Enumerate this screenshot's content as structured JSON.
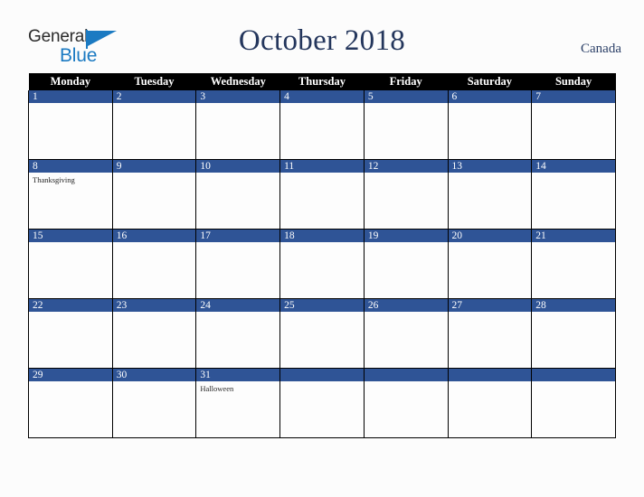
{
  "brand": {
    "name_part1": "General",
    "name_part2": "Blue",
    "triangle_color": "#1b7ac2",
    "text_color": "#2b2b2b"
  },
  "header": {
    "title": "October 2018",
    "country": "Canada",
    "title_color": "#24365c"
  },
  "calendar": {
    "weekday_headers": [
      "Monday",
      "Tuesday",
      "Wednesday",
      "Thursday",
      "Friday",
      "Saturday",
      "Sunday"
    ],
    "header_bg": "#000000",
    "header_text_color": "#ffffff",
    "daynum_bg": "#2f5496",
    "daynum_text_color": "#ffffff",
    "cell_bg": "#fdfdfd",
    "grid_line_color": "#000000",
    "weeks": [
      [
        {
          "day": "1",
          "event": ""
        },
        {
          "day": "2",
          "event": ""
        },
        {
          "day": "3",
          "event": ""
        },
        {
          "day": "4",
          "event": ""
        },
        {
          "day": "5",
          "event": ""
        },
        {
          "day": "6",
          "event": ""
        },
        {
          "day": "7",
          "event": ""
        }
      ],
      [
        {
          "day": "8",
          "event": "Thanksgiving"
        },
        {
          "day": "9",
          "event": ""
        },
        {
          "day": "10",
          "event": ""
        },
        {
          "day": "11",
          "event": ""
        },
        {
          "day": "12",
          "event": ""
        },
        {
          "day": "13",
          "event": ""
        },
        {
          "day": "14",
          "event": ""
        }
      ],
      [
        {
          "day": "15",
          "event": ""
        },
        {
          "day": "16",
          "event": ""
        },
        {
          "day": "17",
          "event": ""
        },
        {
          "day": "18",
          "event": ""
        },
        {
          "day": "19",
          "event": ""
        },
        {
          "day": "20",
          "event": ""
        },
        {
          "day": "21",
          "event": ""
        }
      ],
      [
        {
          "day": "22",
          "event": ""
        },
        {
          "day": "23",
          "event": ""
        },
        {
          "day": "24",
          "event": ""
        },
        {
          "day": "25",
          "event": ""
        },
        {
          "day": "26",
          "event": ""
        },
        {
          "day": "27",
          "event": ""
        },
        {
          "day": "28",
          "event": ""
        }
      ],
      [
        {
          "day": "29",
          "event": ""
        },
        {
          "day": "30",
          "event": ""
        },
        {
          "day": "31",
          "event": "Halloween"
        },
        {
          "day": "",
          "event": ""
        },
        {
          "day": "",
          "event": ""
        },
        {
          "day": "",
          "event": ""
        },
        {
          "day": "",
          "event": ""
        }
      ]
    ]
  }
}
